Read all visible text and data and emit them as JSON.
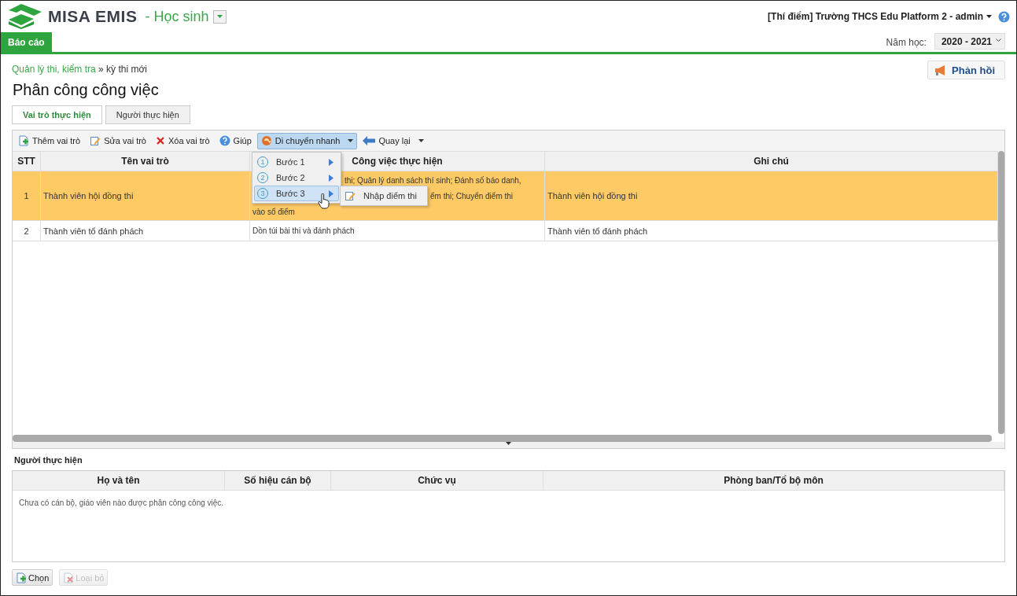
{
  "header": {
    "logo": "MISA EMIS",
    "module": "- Học sinh",
    "account": "[Thí điểm] Trường THCS Edu Platform 2 - admin"
  },
  "nav_tabs": [
    {
      "label": "Báo cáo",
      "selected": true
    }
  ],
  "school_year": {
    "label": "Năm học:",
    "value": "2020 - 2021"
  },
  "breadcrumb": {
    "parent": "Quản lý thi, kiểm tra",
    "separator": "»",
    "current": "kỳ thi mới"
  },
  "feedback_button": "Phản hồi",
  "page_title": "Phân công công việc",
  "tabs": [
    {
      "label": "Vai trò thực hiện",
      "selected": true
    },
    {
      "label": "Người thực hiện",
      "selected": false
    }
  ],
  "toolbar": [
    {
      "label": "Thêm vai trò",
      "kind": "add"
    },
    {
      "label": "Sửa vai trò",
      "kind": "edit"
    },
    {
      "label": "Xóa vai trò",
      "kind": "delete"
    },
    {
      "label": "Giúp",
      "kind": "help"
    },
    {
      "label": "Di chuyển nhanh",
      "kind": "move",
      "dropdown": true,
      "expanded": true
    },
    {
      "label": "Quay lại",
      "kind": "back",
      "dropdown": true,
      "expanded": false
    }
  ],
  "quick_menu": {
    "items": [
      {
        "number": "1",
        "label": "Bước 1",
        "selected": false
      },
      {
        "number": "2",
        "label": "Bước 2",
        "selected": false
      },
      {
        "number": "3",
        "label": "Bước 3",
        "selected": true
      }
    ],
    "submenu": [
      {
        "label": "Nhập điểm thi"
      }
    ]
  },
  "roles_table": {
    "columns": [
      "STT",
      "Tên vai trò",
      "Công việc thực hiện",
      "Ghi chú"
    ],
    "rows": [
      {
        "selected": true,
        "no": "1",
        "name": "Thành viên hội đồng thi",
        "work": [
          {
            "kind": "after-menu",
            "text": "thi; Quản lý danh sách thí sinh; Đánh số báo danh,"
          },
          {
            "kind": "after-submenu",
            "text": "ểm thi; Chuyển điểm thi"
          },
          {
            "kind": "plain",
            "text": "vào sổ điểm"
          }
        ],
        "note": "Thành viên hội đồng thi"
      },
      {
        "selected": false,
        "no": "2",
        "name": "Thành viên tổ đánh phách",
        "work": [
          {
            "kind": "plain",
            "text": "Dồn túi bài thi và đánh phách"
          }
        ],
        "note": "Thành viên tổ đánh phách"
      }
    ]
  },
  "assignees": {
    "title": "Người thực hiện",
    "columns": [
      "Họ và tên",
      "Số hiệu cán bộ",
      "Chức vụ",
      "Phòng ban/Tổ bộ môn"
    ],
    "empty_message": "Chưa có cán bộ, giáo viên nào được phân công công việc."
  },
  "buttons": [
    {
      "label": "Chọn",
      "kind": "add",
      "disabled": false
    },
    {
      "label": "Loại bỏ",
      "kind": "remove",
      "disabled": true
    }
  ]
}
